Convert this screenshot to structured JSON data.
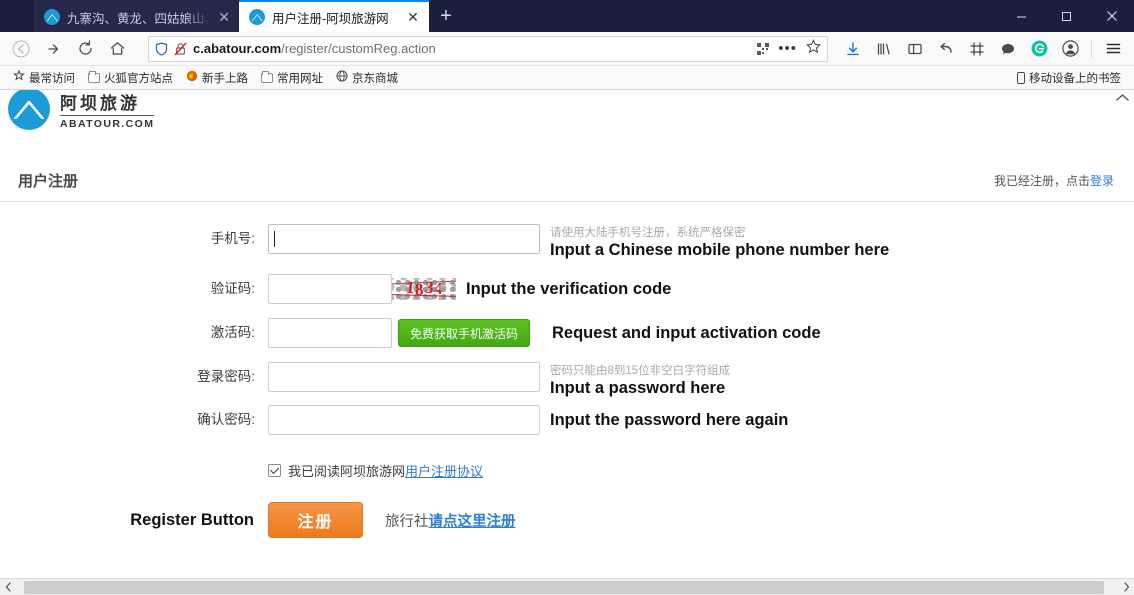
{
  "browser": {
    "tabs": [
      {
        "title": "九寨沟、黄龙、四姑娘山、达古",
        "active": false,
        "close_label": "✕"
      },
      {
        "title": "用户注册-阿坝旅游网",
        "active": true,
        "close_label": "✕"
      }
    ],
    "new_tab_label": "+",
    "window_controls": {
      "minimize": "minimize-button",
      "maximize": "maximize-button",
      "close": "close-button"
    },
    "nav": {
      "back": "back-button",
      "forward": "forward-button",
      "reload": "reload-button",
      "home": "home-button"
    },
    "url": {
      "domain": "c.abatour.com",
      "path": "/register/customReg.action",
      "full": "c.abatour.com/register/customReg.action"
    },
    "toolbar_icons": [
      "download-icon",
      "library-icon",
      "sidebar-icon",
      "pocket-icon",
      "screenshot-icon",
      "chat-icon",
      "grammarly-icon",
      "account-icon",
      "menu-icon"
    ],
    "bookmarks": [
      {
        "label": "最常访问",
        "icon": "star-icon"
      },
      {
        "label": "火狐官方站点",
        "icon": "folder-icon"
      },
      {
        "label": "新手上路",
        "icon": "firefox-icon"
      },
      {
        "label": "常用网址",
        "icon": "folder-icon"
      },
      {
        "label": "京东商城",
        "icon": "globe-icon"
      }
    ],
    "bookmarks_right": {
      "label": "移动设备上的书签",
      "icon": "mobile-icon"
    }
  },
  "site": {
    "logo_cn": "阿坝旅游",
    "logo_en": "ABATOUR.COM",
    "page_title": "用户注册",
    "already_registered_text": "我已经注册，点击",
    "login_link": "登录"
  },
  "form": {
    "phone": {
      "label": "手机号:",
      "value": "",
      "placeholder": "",
      "hint": "请使用大陆手机号注册，系统严格保密",
      "annotation": "Input a Chinese mobile phone number here"
    },
    "captcha": {
      "label": "验证码:",
      "value": "",
      "image_text": "1834",
      "image_digits": [
        "1",
        "8",
        "3",
        "4"
      ],
      "annotation": "Input the verification code"
    },
    "activation": {
      "label": "激活码:",
      "value": "",
      "button_label": "免费获取手机激活码",
      "annotation": "Request and input activation code"
    },
    "password": {
      "label": "登录密码:",
      "value": "",
      "hint": "密码只能由8到15位非空白字符组成",
      "annotation": "Input a password here"
    },
    "confirm_password": {
      "label": "确认密码:",
      "value": "",
      "annotation": "Input the password here again"
    },
    "agreement": {
      "checked": true,
      "text": "我已阅读阿坝旅游网",
      "link": "用户注册协议"
    },
    "submit": {
      "annotation": "Register Button",
      "button_label": "注册",
      "agency_text": "旅行社",
      "agency_link": "请点这里注册"
    }
  },
  "colors": {
    "tab_accent": "#0a84ff",
    "brand_blue": "#1b9bd8",
    "link_blue": "#2b7fd4",
    "green_button": "#4fb61a",
    "orange_button": "#ee8029",
    "captcha_red": "#d81a1a",
    "titlebar_bg": "#1c1f3b"
  }
}
